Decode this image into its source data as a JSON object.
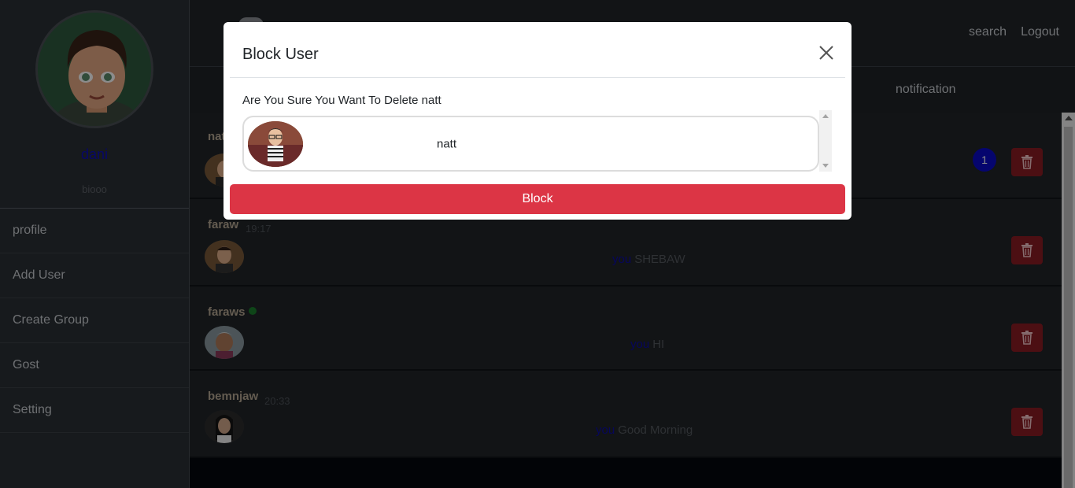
{
  "sidebar": {
    "profile_name": "dani",
    "profile_bio": "biooo",
    "items": [
      {
        "label": "profile"
      },
      {
        "label": "Add User"
      },
      {
        "label": "Create Group"
      },
      {
        "label": "Gost"
      },
      {
        "label": "Setting"
      }
    ]
  },
  "topnav": {
    "search_label": "search",
    "logout_label": "Logout"
  },
  "tabs": {
    "notification_label": "notification"
  },
  "chats": [
    {
      "name": "nat",
      "time": "",
      "you": "",
      "message": "",
      "unread": "1",
      "online": false
    },
    {
      "name": "faraw",
      "time": "19:17",
      "you": "you",
      "message": "SHEBAW",
      "online": false
    },
    {
      "name": "faraws",
      "time": "",
      "you": "you",
      "message": "HI",
      "online": true
    },
    {
      "name": "bemnjaw",
      "time": "20:33",
      "you": "you",
      "message": "Good Morning",
      "online": false
    }
  ],
  "modal": {
    "title": "Block User",
    "question": "Are You Sure You Want To Delete natt",
    "user_name": "natt",
    "block_label": "Block"
  },
  "colors": {
    "accent_danger": "#dc3545",
    "name_blue": "#0d0dbd",
    "badge_blue": "#0a0ac8",
    "online_green": "#1a7f2c"
  }
}
